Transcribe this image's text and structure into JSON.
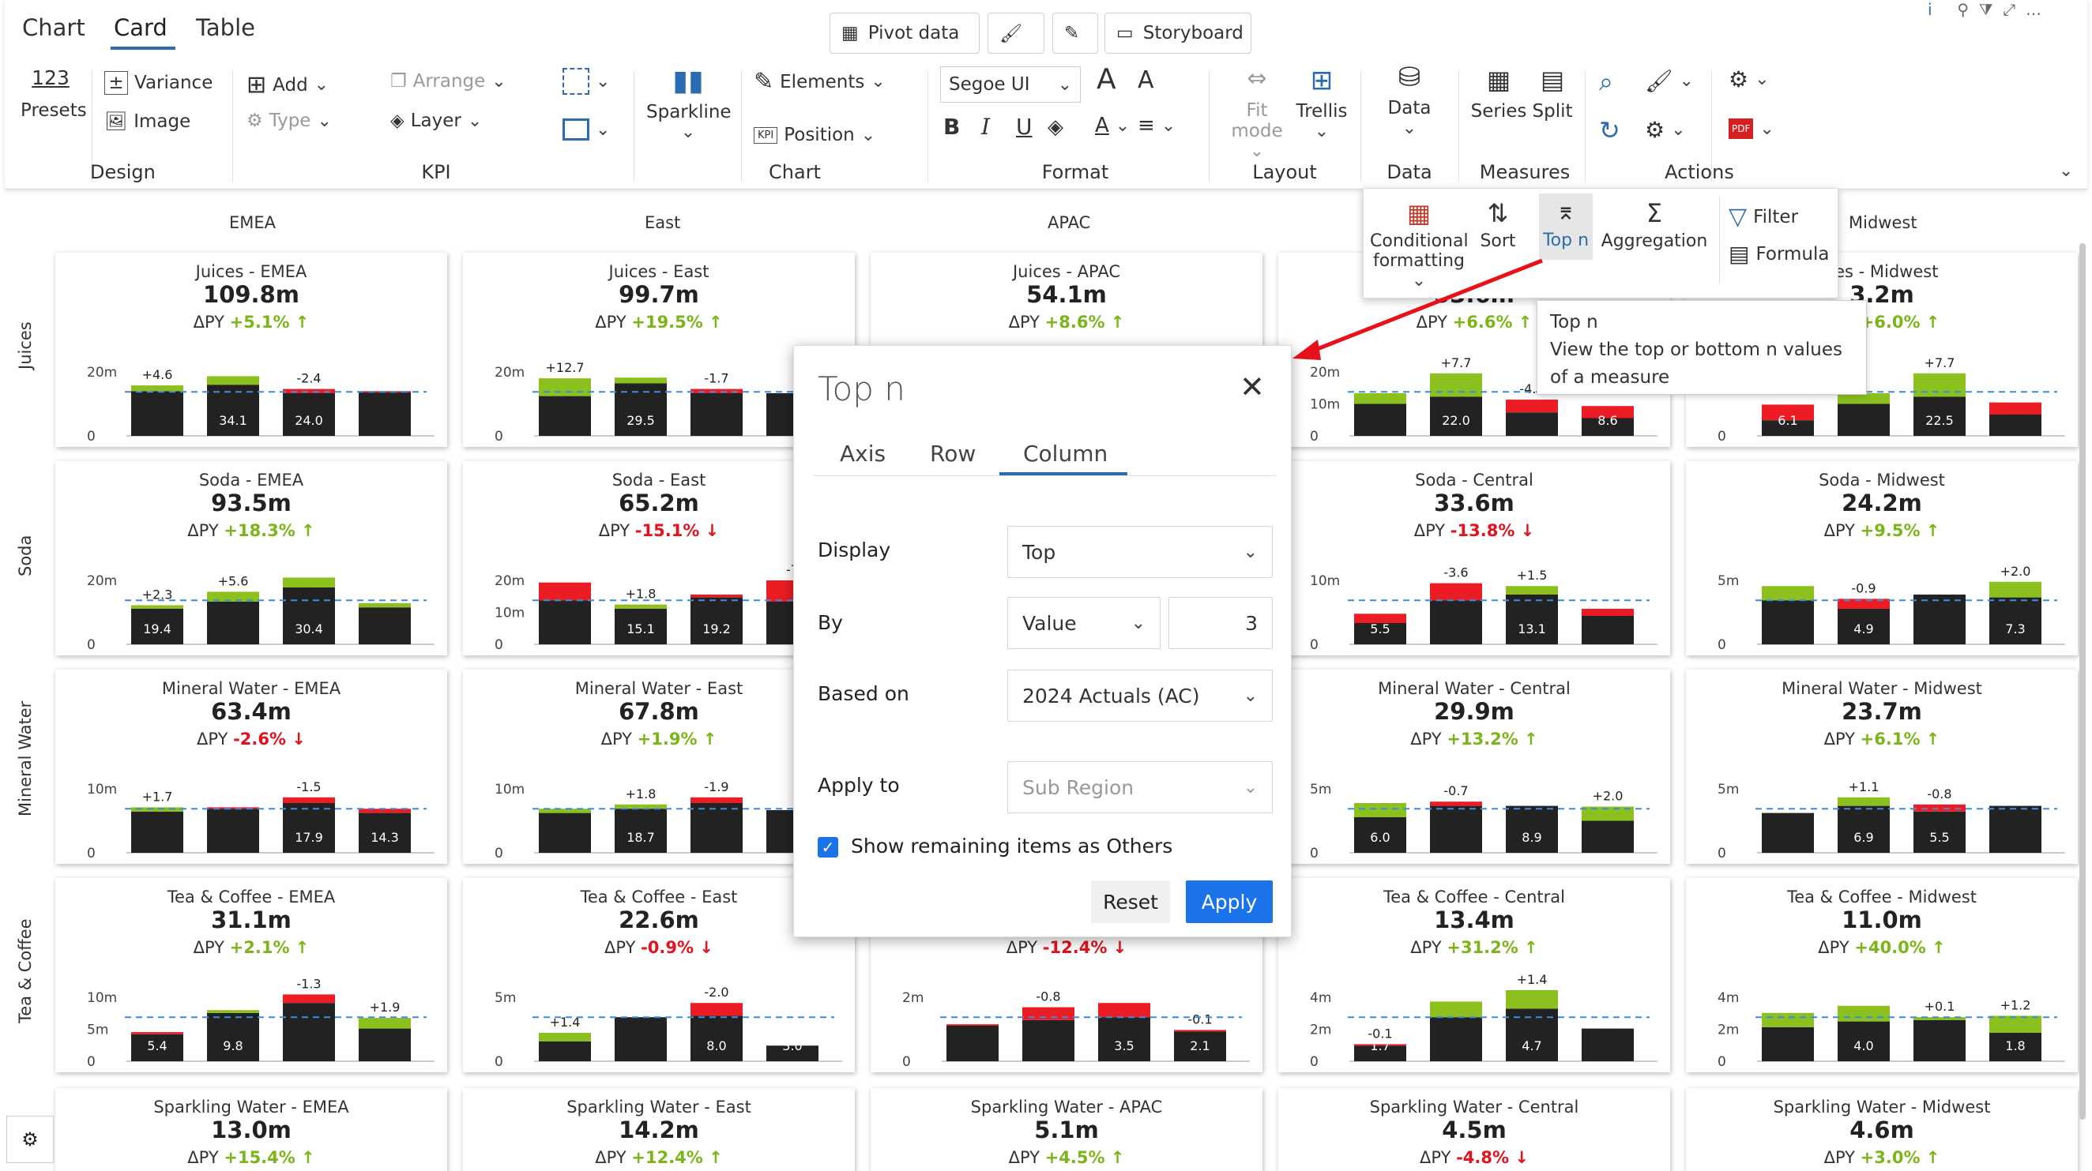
{
  "tabs": [
    "Chart",
    "Card",
    "Table"
  ],
  "top_buttons": [
    "Pivot data",
    "Storyboard"
  ],
  "ribbon": {
    "presets": {
      "icon_text": "123",
      "label": "Presets"
    },
    "design": {
      "variance": "Variance",
      "image": "Image",
      "group": "Design"
    },
    "kpi": {
      "add": "Add",
      "type": "Type",
      "arrange": "Arrange",
      "layer": "Layer",
      "group": "KPI"
    },
    "chart": {
      "sparkline": "Sparkline",
      "elements": "Elements",
      "position": "Position",
      "group": "Chart",
      "kpi_badge": "KPI"
    },
    "format": {
      "font": "Segoe UI",
      "group": "Format",
      "bold": "B",
      "italic": "I",
      "underline": "U",
      "grow": "A",
      "shrink": "A"
    },
    "layout": {
      "fit_mode": "Fit mode",
      "trellis": "Trellis",
      "group": "Layout"
    },
    "data": {
      "label": "Data",
      "group": "Data"
    },
    "measures": {
      "series": "Series",
      "split": "Split",
      "group": "Measures"
    },
    "actions": {
      "group": "Actions"
    }
  },
  "flyout": {
    "conditional": "Conditional",
    "formatting": "formatting",
    "sort": "Sort",
    "topn": "Top n",
    "aggregation": "Aggregation",
    "filter": "Filter",
    "formula": "Formula"
  },
  "tooltip": {
    "title": "Top n",
    "line1": "View the top or bottom n values",
    "line2": "of a measure"
  },
  "popup": {
    "title": "Top n",
    "tabs": [
      "Axis",
      "Row",
      "Column"
    ],
    "display_label": "Display",
    "display_value": "Top",
    "by_label": "By",
    "by_value": "Value",
    "by_n": "3",
    "based_label": "Based on",
    "based_value": "2024 Actuals (AC)",
    "apply_label": "Apply to",
    "apply_placeholder": "Sub Region",
    "checkbox_label": "Show remaining items as Others",
    "reset": "Reset",
    "apply": "Apply"
  },
  "columns": [
    "EMEA",
    "East",
    "APAC",
    "Midwest"
  ],
  "rows": [
    "Juices",
    "Soda",
    "Mineral Water",
    "Tea & Coffee"
  ],
  "delta_label": "ΔPY",
  "cards": [
    {
      "title": "Juices - EMEA",
      "value": "109.8m",
      "delta": "+5.1%",
      "dir": "up",
      "axis": [
        "20m",
        "0"
      ],
      "bars": [
        {
          "ac": 0.63,
          "dv": 0.08,
          "dl": "+4.6"
        },
        {
          "ac": 0.72,
          "dv": 0.12,
          "dl": "34.1"
        },
        {
          "ac": 0.6,
          "dv": -0.06,
          "dl": "-2.4",
          "in": "24.0"
        },
        {
          "ac": 0.61,
          "dv": -0.02,
          "dl": ""
        }
      ],
      "labels_in": [
        "",
        "34.1",
        "24.0",
        ""
      ]
    },
    {
      "title": "Juices - East",
      "value": "99.7m",
      "delta": "+19.5%",
      "dir": "up",
      "axis": [
        "20m",
        "0"
      ],
      "bars": [
        {
          "ac": 0.56,
          "dv": 0.25,
          "dl": "+12.7"
        },
        {
          "ac": 0.74,
          "dv": 0.08,
          "dl": ""
        },
        {
          "ac": 0.6,
          "dv": -0.06,
          "dl": "-1.7"
        },
        {
          "ac": 0.6,
          "dv": 0.0,
          "dl": ""
        }
      ],
      "labels_in": [
        "",
        "29.5",
        "",
        ""
      ]
    },
    {
      "title": "Juices - APAC",
      "value": "54.1m",
      "delta": "+8.6%",
      "dir": "up",
      "axis": [],
      "bars": [],
      "labels_in": []
    },
    {
      "title": "",
      "value": "53.6m",
      "delta": "+6.6%",
      "dir": "up",
      "axis": [
        "20m",
        "10m",
        "0"
      ],
      "bars": [
        {
          "ac": 0.45,
          "dv": 0.15,
          "dl": ""
        },
        {
          "ac": 0.55,
          "dv": 0.33,
          "dl": "+7.7"
        },
        {
          "ac": 0.33,
          "dv": -0.18,
          "dl": "-4.2"
        },
        {
          "ac": 0.25,
          "dv": -0.17,
          "dl": ""
        }
      ],
      "labels_in": [
        "",
        "22.0",
        "",
        "8.6"
      ]
    },
    {
      "title": "ces - Midwest",
      "value": "3.2m",
      "delta": "+6.0%",
      "dir": "up",
      "axis": [
        "10m",
        "0"
      ],
      "bars": [
        {
          "ac": 0.22,
          "dv": -0.22,
          "dl": ""
        },
        {
          "ac": 0.45,
          "dv": 0.15,
          "dl": ""
        },
        {
          "ac": 0.55,
          "dv": 0.33,
          "dl": "+7.7"
        },
        {
          "ac": 0.3,
          "dv": -0.17,
          "dl": ""
        }
      ],
      "labels_in": [
        "6.1",
        "",
        "22.5",
        ""
      ]
    },
    {
      "title": "Soda - EMEA",
      "value": "93.5m",
      "delta": "+18.3%",
      "dir": "up",
      "axis": [
        "20m",
        "0"
      ],
      "bars": [
        {
          "ac": 0.5,
          "dv": 0.05,
          "dl": "+2.3"
        },
        {
          "ac": 0.6,
          "dv": 0.14,
          "dl": "+5.6"
        },
        {
          "ac": 0.8,
          "dv": 0.14,
          "dl": ""
        },
        {
          "ac": 0.52,
          "dv": 0.06,
          "dl": ""
        }
      ],
      "labels_in": [
        "19.4",
        "",
        "30.4",
        ""
      ]
    },
    {
      "title": "Soda - East",
      "value": "65.2m",
      "delta": "-15.1%",
      "dir": "down",
      "axis": [
        "20m",
        "10m",
        "0"
      ],
      "bars": [
        {
          "ac": 0.62,
          "dv": -0.25,
          "dl": ""
        },
        {
          "ac": 0.5,
          "dv": 0.06,
          "dl": "+1.8"
        },
        {
          "ac": 0.66,
          "dv": -0.04,
          "dl": ""
        },
        {
          "ac": 0.6,
          "dv": -0.3,
          "dl": "-7"
        }
      ],
      "labels_in": [
        "",
        "15.1",
        "19.2",
        ""
      ]
    },
    {
      "title": "",
      "value": "",
      "delta": "",
      "dir": "",
      "axis": [],
      "bars": [],
      "labels_in": []
    },
    {
      "title": "Soda - Central",
      "value": "33.6m",
      "delta": "-13.8%",
      "dir": "down",
      "axis": [
        "10m",
        "0"
      ],
      "bars": [
        {
          "ac": 0.3,
          "dv": -0.13,
          "dl": ""
        },
        {
          "ac": 0.62,
          "dv": -0.24,
          "dl": "-3.6"
        },
        {
          "ac": 0.7,
          "dv": 0.12,
          "dl": "+1.5"
        },
        {
          "ac": 0.4,
          "dv": -0.1,
          "dl": ""
        }
      ],
      "labels_in": [
        "5.5",
        "",
        "13.1",
        ""
      ]
    },
    {
      "title": "Soda - Midwest",
      "value": "24.2m",
      "delta": "+9.5%",
      "dir": "up",
      "axis": [
        "5m",
        "0"
      ],
      "bars": [
        {
          "ac": 0.62,
          "dv": 0.2,
          "dl": ""
        },
        {
          "ac": 0.5,
          "dv": -0.14,
          "dl": "-0.9"
        },
        {
          "ac": 0.7,
          "dv": 0.0,
          "dl": ""
        },
        {
          "ac": 0.66,
          "dv": 0.22,
          "dl": "+2.0"
        }
      ],
      "labels_in": [
        "",
        "4.9",
        "",
        "7.3"
      ]
    },
    {
      "title": "Mineral Water - EMEA",
      "value": "63.4m",
      "delta": "-2.6%",
      "dir": "down",
      "axis": [
        "10m",
        "0"
      ],
      "bars": [
        {
          "ac": 0.58,
          "dv": 0.06,
          "dl": "+1.7"
        },
        {
          "ac": 0.62,
          "dv": -0.02,
          "dl": ""
        },
        {
          "ac": 0.7,
          "dv": -0.08,
          "dl": "-1.5"
        },
        {
          "ac": 0.56,
          "dv": -0.06,
          "dl": ""
        }
      ],
      "labels_in": [
        "",
        "",
        "17.9",
        "14.3"
      ]
    },
    {
      "title": "Mineral Water - East",
      "value": "67.8m",
      "delta": "+1.9%",
      "dir": "up",
      "axis": [
        "10m",
        "0"
      ],
      "bars": [
        {
          "ac": 0.56,
          "dv": 0.06,
          "dl": ""
        },
        {
          "ac": 0.62,
          "dv": 0.06,
          "dl": "+1.8"
        },
        {
          "ac": 0.7,
          "dv": -0.08,
          "dl": "-1.9"
        },
        {
          "ac": 0.6,
          "dv": 0.0,
          "dl": ""
        }
      ],
      "labels_in": [
        "",
        "18.7",
        "",
        ""
      ]
    },
    {
      "title": "",
      "value": "",
      "delta": "",
      "dir": "",
      "axis": [],
      "bars": [],
      "labels_in": []
    },
    {
      "title": "Mineral Water - Central",
      "value": "29.9m",
      "delta": "+13.2%",
      "dir": "up",
      "axis": [
        "5m",
        "0"
      ],
      "bars": [
        {
          "ac": 0.5,
          "dv": 0.2,
          "dl": ""
        },
        {
          "ac": 0.66,
          "dv": -0.06,
          "dl": "-0.7"
        },
        {
          "ac": 0.66,
          "dv": 0.0,
          "dl": ""
        },
        {
          "ac": 0.45,
          "dv": 0.2,
          "dl": "+2.0"
        }
      ],
      "labels_in": [
        "6.0",
        "",
        "8.9",
        ""
      ]
    },
    {
      "title": "Mineral Water - Midwest",
      "value": "23.7m",
      "delta": "+6.1%",
      "dir": "up",
      "axis": [
        "5m",
        "0"
      ],
      "bars": [
        {
          "ac": 0.56,
          "dv": 0.0,
          "dl": ""
        },
        {
          "ac": 0.66,
          "dv": 0.12,
          "dl": "+1.1"
        },
        {
          "ac": 0.58,
          "dv": -0.1,
          "dl": "-0.8"
        },
        {
          "ac": 0.66,
          "dv": 0.0,
          "dl": ""
        }
      ],
      "labels_in": [
        "",
        "6.9",
        "5.5",
        ""
      ]
    },
    {
      "title": "Tea & Coffee - EMEA",
      "value": "31.1m",
      "delta": "+2.1%",
      "dir": "up",
      "axis": [
        "10m",
        "5m",
        "0"
      ],
      "bars": [
        {
          "ac": 0.38,
          "dv": -0.03,
          "dl": ""
        },
        {
          "ac": 0.68,
          "dv": 0.04,
          "dl": ""
        },
        {
          "ac": 0.82,
          "dv": -0.12,
          "dl": "-1.3"
        },
        {
          "ac": 0.46,
          "dv": 0.15,
          "dl": "+1.9"
        }
      ],
      "labels_in": [
        "5.4",
        "9.8",
        "",
        ""
      ]
    },
    {
      "title": "Tea & Coffee - East",
      "value": "22.6m",
      "delta": "-0.9%",
      "dir": "down",
      "axis": [
        "5m",
        "0"
      ],
      "bars": [
        {
          "ac": 0.28,
          "dv": 0.12,
          "dl": "+1.4"
        },
        {
          "ac": 0.62,
          "dv": 0.0,
          "dl": ""
        },
        {
          "ac": 0.64,
          "dv": -0.18,
          "dl": "-2.0"
        },
        {
          "ac": 0.22,
          "dv": 0.0,
          "dl": ""
        }
      ],
      "labels_in": [
        "",
        "",
        "8.0",
        "3.0"
      ]
    },
    {
      "title": "",
      "value": "",
      "delta": "-12.4%",
      "dir": "down",
      "axis": [
        "2m",
        "0"
      ],
      "bars": [
        {
          "ac": 0.5,
          "dv": -0.02,
          "dl": ""
        },
        {
          "ac": 0.58,
          "dv": -0.18,
          "dl": "-0.8"
        },
        {
          "ac": 0.62,
          "dv": -0.2,
          "dl": ""
        },
        {
          "ac": 0.42,
          "dv": -0.02,
          "dl": "-0.1"
        }
      ],
      "labels_in": [
        "",
        "",
        "3.5",
        "2.1"
      ]
    },
    {
      "title": "Tea & Coffee - Central",
      "value": "13.4m",
      "delta": "+31.2%",
      "dir": "up",
      "axis": [
        "4m",
        "2m",
        "0"
      ],
      "bars": [
        {
          "ac": 0.22,
          "dv": -0.02,
          "dl": "-0.1"
        },
        {
          "ac": 0.62,
          "dv": 0.22,
          "dl": ""
        },
        {
          "ac": 0.74,
          "dv": 0.26,
          "dl": "+1.4"
        },
        {
          "ac": 0.46,
          "dv": 0.0,
          "dl": ""
        }
      ],
      "labels_in": [
        "1.7",
        "",
        "4.7",
        ""
      ]
    },
    {
      "title": "Tea & Coffee - Midwest",
      "value": "11.0m",
      "delta": "+40.0%",
      "dir": "up",
      "axis": [
        "4m",
        "2m",
        "0"
      ],
      "bars": [
        {
          "ac": 0.48,
          "dv": 0.2,
          "dl": ""
        },
        {
          "ac": 0.56,
          "dv": 0.22,
          "dl": ""
        },
        {
          "ac": 0.58,
          "dv": 0.04,
          "dl": "+0.1"
        },
        {
          "ac": 0.4,
          "dv": 0.24,
          "dl": "+1.2"
        }
      ],
      "labels_in": [
        "",
        "4.0",
        "",
        "1.8"
      ]
    }
  ],
  "bottom_cards": [
    {
      "title": "Sparkling Water - EMEA",
      "value": "13.0m",
      "delta": "+15.4%",
      "dir": "up"
    },
    {
      "title": "Sparkling Water - East",
      "value": "14.2m",
      "delta": "+12.4%",
      "dir": "up"
    },
    {
      "title": "Sparkling Water - APAC",
      "value": "5.1m",
      "delta": "+4.5%",
      "dir": "up"
    },
    {
      "title": "Sparkling Water - Central",
      "value": "4.5m",
      "delta": "-4.8%",
      "dir": "down"
    },
    {
      "title": "Sparkling Water - Midwest",
      "value": "4.6m",
      "delta": "+3.0%",
      "dir": "up"
    }
  ],
  "colors": {
    "actual": "#222222",
    "positive": "#8cc01f",
    "negative": "#ec1c24",
    "ref": "#3a8dde",
    "accent": "#1a73e8"
  }
}
